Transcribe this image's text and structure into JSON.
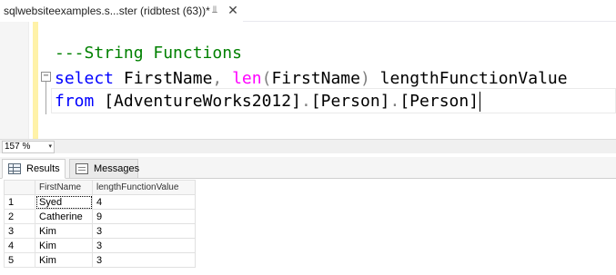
{
  "document_tab": {
    "title": "sqlwebsiteexamples.s...ster (ridbtest (63))*",
    "pin_icon": "pin-icon",
    "close_icon": "close-icon"
  },
  "editor": {
    "lines": [
      {
        "comment": "---String Functions"
      },
      {
        "kw_select": "select",
        "text1": " FirstName",
        "op_comma": ",",
        "space": " ",
        "fn_len": "len",
        "op_lparen": "(",
        "arg": "FirstName",
        "op_rparen": ")",
        "alias": " lengthFunctionValue"
      },
      {
        "kw_from": "from",
        "space": " ",
        "db": "[AdventureWorks2012]",
        "dot1": ".",
        "schema": "[Person]",
        "dot2": ".",
        "table": "[Person]"
      }
    ],
    "collapse_symbol": "−"
  },
  "zoom": {
    "value": "157 %",
    "arrow": "▾"
  },
  "results_pane": {
    "tabs": [
      {
        "label": "Results",
        "icon": "grid-icon"
      },
      {
        "label": "Messages",
        "icon": "messages-icon"
      }
    ],
    "columns": [
      "FirstName",
      "lengthFunctionValue"
    ],
    "rows": [
      {
        "num": "1",
        "FirstName": "Syed",
        "lengthFunctionValue": "4"
      },
      {
        "num": "2",
        "FirstName": "Catherine",
        "lengthFunctionValue": "9"
      },
      {
        "num": "3",
        "FirstName": "Kim",
        "lengthFunctionValue": "3"
      },
      {
        "num": "4",
        "FirstName": "Kim",
        "lengthFunctionValue": "3"
      },
      {
        "num": "5",
        "FirstName": "Kim",
        "lengthFunctionValue": "3"
      }
    ]
  },
  "colors": {
    "comment": "#008000",
    "keyword": "#0000ff",
    "function": "#ff00ff",
    "operator": "#808080",
    "change_bar": "#fff2a8"
  }
}
